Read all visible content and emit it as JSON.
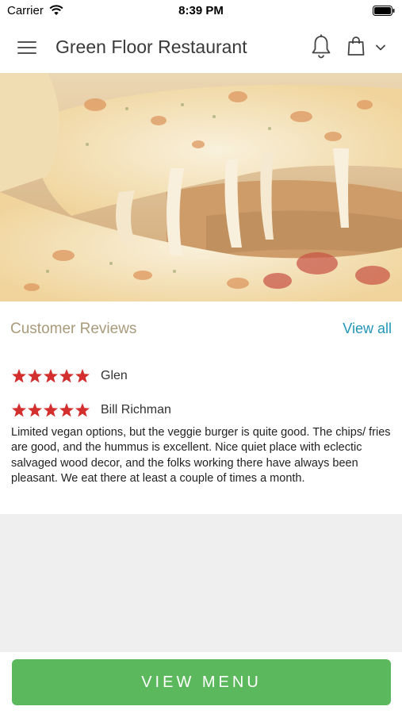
{
  "status_bar": {
    "carrier": "Carrier",
    "time": "8:39 PM"
  },
  "nav": {
    "title": "Green Floor Restaurant",
    "icons": [
      "menu-icon",
      "bell-icon",
      "shopping-bag-icon",
      "chevron-down-icon"
    ]
  },
  "hero": {
    "image": "pizza-cheese-pull-photo"
  },
  "reviews": {
    "title": "Customer Reviews",
    "view_all_label": "View all",
    "items": [
      {
        "name": "Glen",
        "rating": 5
      },
      {
        "name": "Bill Richman",
        "rating": 5,
        "text": "Limited vegan options, but the veggie burger is quite good.  The chips/ fries are good, and the hummus is excellent.  Nice quiet place with eclectic salvaged wood decor, and the folks working there have always been pleasant.  We eat there at least a couple of times a month."
      }
    ]
  },
  "footer": {
    "button_label": "VIEW MENU"
  },
  "colors": {
    "accent_green": "#5cb85c",
    "link_blue": "#2196b8",
    "star_red": "#d32f2f",
    "section_title": "#a99a7b"
  }
}
